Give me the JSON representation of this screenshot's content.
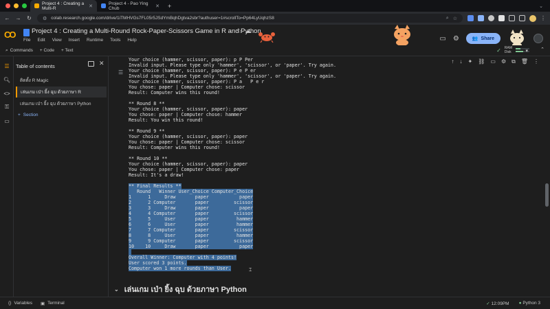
{
  "browser": {
    "tabs": [
      {
        "title": "Project 4 : Creating a Multi-R",
        "active": true
      },
      {
        "title": "Project 4 - Pao Ying Chub",
        "active": false
      }
    ],
    "url": "colab.research.google.com/drive/1iTMHVGs7FL05r5JSdYmBqhDgtva2sbr?authuser=1#scrollTo=Pp64LyUqhzS8",
    "traffic_colors": [
      "#ff5f57",
      "#febc2e",
      "#28c840"
    ]
  },
  "colab": {
    "logo": "CO",
    "title": "Project 4 : Creating a Multi-Round Rock-Paper-Scissors Game in  R and  Python",
    "menu": [
      "File",
      "Edit",
      "View",
      "Insert",
      "Runtime",
      "Tools",
      "Help"
    ],
    "share_label": "Share",
    "toolbar": {
      "commands": "Commands",
      "code": "+ Code",
      "text": "+ Text"
    },
    "resources": {
      "ram_label": "RAM",
      "disk_label": "Disk",
      "ram_level": 0.35,
      "disk_level": 0.55
    }
  },
  "toc": {
    "title": "Table of contents",
    "items": [
      "ติดตั้ง R Magic",
      "เล่นเกม เป่า ยิ้ง ฉุบ ด้วยภาษา R",
      "เล่นเกม เป่า ยิ้ง ฉุบ ด้วยภาษา Python"
    ],
    "active_index": 1,
    "add_section": "Section"
  },
  "output_lines": [
    "Your choice (hammer, scissor, paper): p P Per",
    "Invalid input. Please type only 'hammer', 'scissor', or 'paper'. Try again.",
    "Your choice (hammer, scissor, paper): P e P er",
    "Invalid input. Please type only 'hammer', 'scissor', or 'paper'. Try again.",
    "Your choice (hammer, scissor, paper): P a   P e r",
    "You chose: paper | Computer chose: scissor",
    "Result: Computer wins this round!",
    "",
    "** Round 8 **",
    "Your choice (hammer, scissor, paper): paper",
    "You chose: paper | Computer chose: hammer",
    "Result: You win this round!",
    "",
    "** Round 9 **",
    "Your choice (hammer, scissor, paper): paper",
    "You chose: paper | Computer chose: scissor",
    "Result: Computer wins this round!",
    "",
    "** Round 10 **",
    "Your choice (hammer, scissor, paper): paper",
    "You chose: paper | Computer chose: paper",
    "Result: It's a draw!",
    ""
  ],
  "selected_lines": [
    "** Final Results **",
    "   Round   Winner User_Choice Computer_Choice",
    "1      1     Draw       paper           paper",
    "2      2 Computer       paper         scissor",
    "3      3     Draw       paper           paper",
    "4      4 Computer       paper         scissor",
    "5      5     User       paper          hammer",
    "6      6     User       paper          hammer",
    "7      7 Computer       paper         scissor",
    "8      8     User       paper          hammer",
    "9      9 Computer       paper         scissor",
    "10    10     Draw       paper           paper",
    "",
    "Overall Winner: Computer with 4 points!",
    "User scored 3 points.",
    "Computer won 1 more rounds than User."
  ],
  "section_heading": "เล่นเกม เป่า ยิ้ง ฉุบ ด้วยภาษา Python",
  "statusbar": {
    "variables": "Variables",
    "terminal": "Terminal",
    "time": "12:09PM",
    "runtime": "Python 3"
  }
}
